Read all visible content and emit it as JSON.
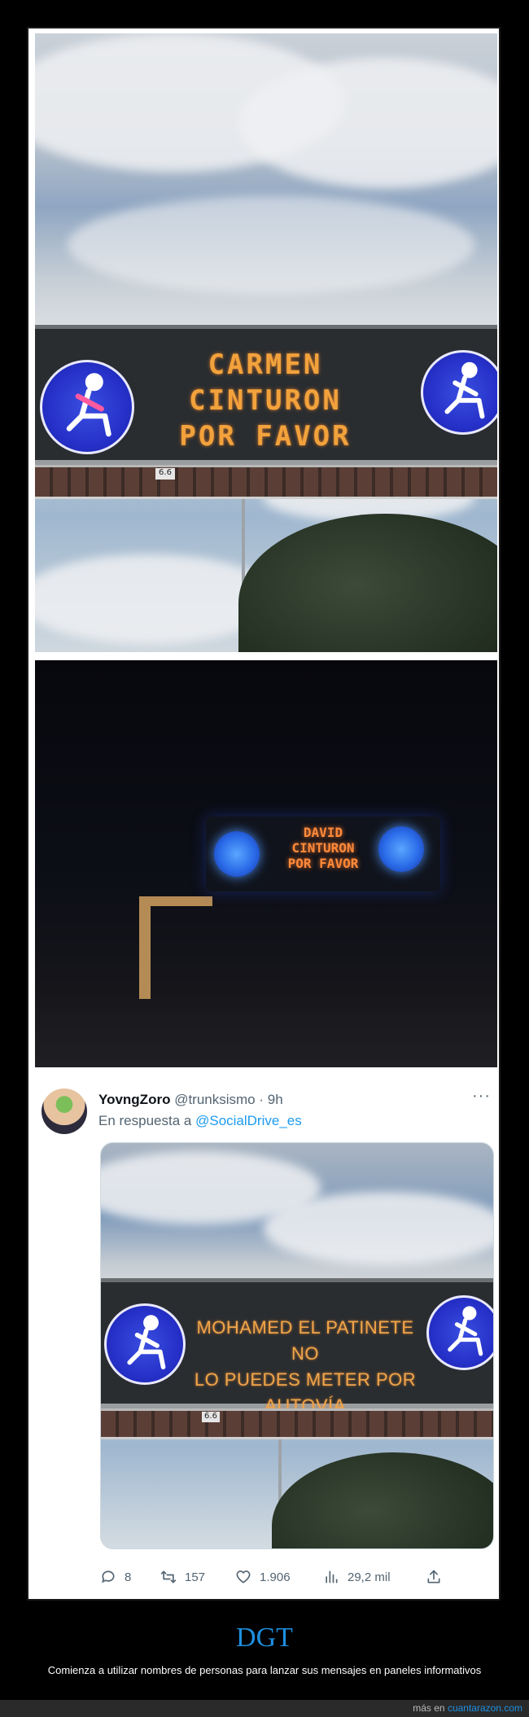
{
  "panel1": {
    "sign_lines": [
      "CARMEN",
      "CINTURON",
      "POR FAVOR"
    ],
    "plate": "6.6"
  },
  "panel2": {
    "sign_lines": [
      "DAVID",
      "CINTURON",
      "POR FAVOR"
    ]
  },
  "tweet": {
    "display_name": "YovngZoro",
    "handle": "@trunksismo",
    "time": "· 9h",
    "reply_prefix": "En respuesta a",
    "reply_mention": "@SocialDrive_es",
    "more": "···",
    "sign_lines": [
      "MOHAMED EL PATINETE NO",
      "LO PUEDES METER POR AUTOVÍA"
    ],
    "plate": "6.6",
    "actions": {
      "replies": "8",
      "retweets": "157",
      "likes": "1.906",
      "views": "29,2 mil"
    }
  },
  "caption": {
    "title": "DGT",
    "subtitle": "Comienza a utilizar nombres de personas para lanzar sus mensajes en paneles informativos"
  },
  "footer": {
    "prefix": "más en",
    "site": "cuantarazon.com"
  }
}
